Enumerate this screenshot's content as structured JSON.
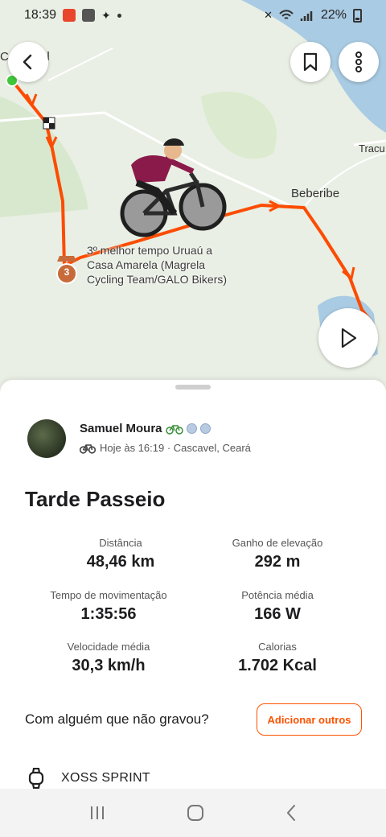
{
  "status_bar": {
    "time": "18:39",
    "battery": "22%"
  },
  "map": {
    "place_labels": {
      "cascavel": "Cascavel",
      "beberibe": "Beberibe",
      "tracu": "Tracu"
    },
    "segment_rank": "3",
    "segment_label": "3º melhor tempo Uruaú a Casa Amarela (Magrela Cycling Team/GALO Bikers)"
  },
  "colors": {
    "route": "#fc4c02",
    "accent": "#fc5200",
    "water": "#a9cbe3",
    "start": "#3fc73a"
  },
  "icons": {
    "back": "chevron-left-icon",
    "save": "bookmark-icon",
    "more": "more-vertical-icon",
    "play": "play-icon",
    "bike": "bike-icon",
    "watch": "watch-icon"
  },
  "activity": {
    "athlete_name": "Samuel Moura",
    "meta": "Hoje às 16:19 · Cascavel, Ceará",
    "title": "Tarde Passeio",
    "stats": [
      {
        "label": "Distância",
        "value": "48,46 km"
      },
      {
        "label": "Ganho de elevação",
        "value": "292 m"
      },
      {
        "label": "Tempo de movimentação",
        "value": "1:35:56"
      },
      {
        "label": "Potência média",
        "value": "166 W"
      },
      {
        "label": "Velocidade média",
        "value": "30,3 km/h"
      },
      {
        "label": "Calorias",
        "value": "1.702 Kcal"
      }
    ],
    "with_others_question": "Com alguém que não gravou?",
    "add_others_label": "Adicionar outros",
    "device": "XOSS SPRINT"
  }
}
